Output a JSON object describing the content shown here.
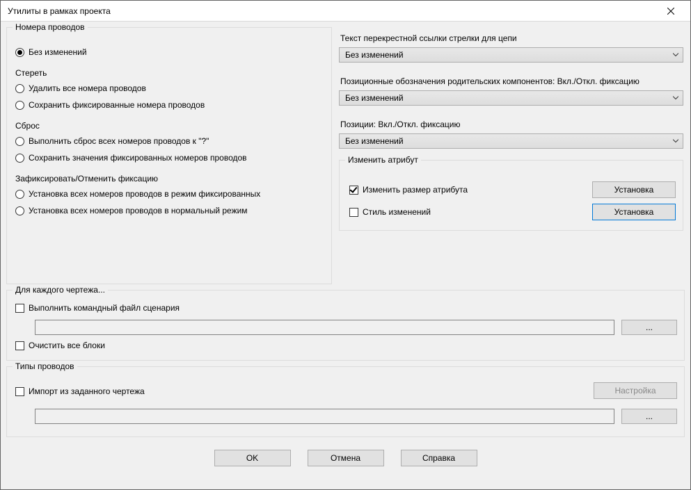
{
  "window": {
    "title": "Утилиты в рамках проекта"
  },
  "wires": {
    "legend": "Номера проводов",
    "noChange": "Без изменений",
    "eraseLabel": "Стереть",
    "eraseAll": "Удалить все номера проводов",
    "keepFixed": "Сохранить фиксированные номера проводов",
    "resetLabel": "Сброс",
    "resetAll": "Выполнить сброс всех номеров проводов к \"?\"",
    "keepFixedValues": "Сохранить значения фиксированных номеров проводов",
    "fixLabel": "Зафиксировать/Отменить фиксацию",
    "setAllFixed": "Установка всех номеров проводов в режим фиксированных",
    "setAllNormal": "Установка всех номеров проводов в нормальный режим"
  },
  "right": {
    "xrefLabel": "Текст перекрестной ссылки стрелки для цепи",
    "xrefValue": "Без изменений",
    "parentLabel": "Позиционные обозначения родительских компонентов: Вкл./Откл. фиксацию",
    "parentValue": "Без изменений",
    "posLabel": "Позиции: Вкл./Откл. фиксацию",
    "posValue": "Без изменений"
  },
  "attr": {
    "legend": "Изменить атрибут",
    "resize": "Изменить размер атрибута",
    "style": "Стиль изменений",
    "setup": "Установка"
  },
  "foreach": {
    "legend": "Для каждого чертежа...",
    "runScript": "Выполнить командный файл сценария",
    "browse": "...",
    "purge": "Очистить все блоки"
  },
  "wiretypes": {
    "legend": "Типы проводов",
    "importFrom": "Импорт из заданного чертежа",
    "setup": "Настройка",
    "browse": "..."
  },
  "buttons": {
    "ok": "OK",
    "cancel": "Отмена",
    "help": "Справка"
  }
}
